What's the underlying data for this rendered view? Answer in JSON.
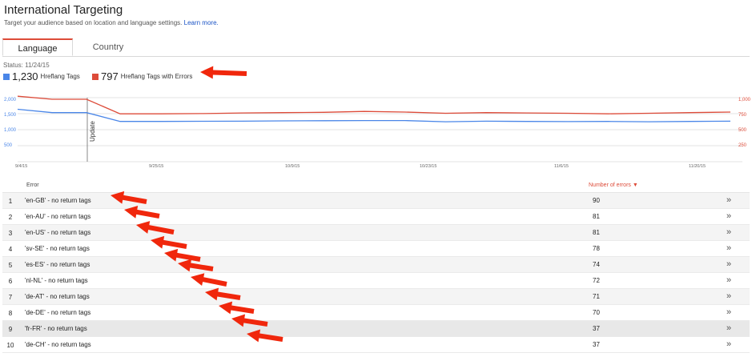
{
  "page": {
    "title": "International Targeting",
    "subtitle": "Target your audience based on location and language settings.",
    "learn_more": "Learn more."
  },
  "tabs": [
    {
      "label": "Language",
      "active": true
    },
    {
      "label": "Country",
      "active": false
    }
  ],
  "status": "Status: 11/24/15",
  "legend": [
    {
      "value": "1,230",
      "label": "Hreflang Tags",
      "color": "#4a86e8"
    },
    {
      "value": "797",
      "label": "Hreflang Tags with Errors",
      "color": "#dd4b39"
    }
  ],
  "chart_data": {
    "type": "line",
    "x_ticks": [
      "9/4/15",
      "9/25/15",
      "10/9/15",
      "10/23/15",
      "11/6/15",
      "11/20/15"
    ],
    "left_axis_ticks": [
      "2,000",
      "1,500",
      "1,000",
      "500"
    ],
    "right_axis_ticks": [
      "1,000",
      "750",
      "500",
      "250"
    ],
    "annotation": "Update",
    "series": [
      {
        "name": "Hreflang Tags",
        "color": "#4a86e8",
        "values": [
          1670,
          1560,
          1560,
          1270,
          1270,
          1275,
          1280,
          1290,
          1295,
          1300,
          1300,
          1260,
          1280,
          1270,
          1265,
          1270,
          1260,
          1270,
          1280
        ]
      },
      {
        "name": "Hreflang Tags with Errors",
        "color": "#dd4b39",
        "values": [
          1050,
          1000,
          1000,
          760,
          760,
          765,
          775,
          780,
          785,
          800,
          790,
          770,
          780,
          775,
          770,
          760,
          770,
          780,
          790
        ]
      }
    ]
  },
  "table": {
    "col_error": "Error",
    "col_count": "Number of errors",
    "rows": [
      {
        "idx": "1",
        "error": "'en-GB' - no return tags",
        "count": "90"
      },
      {
        "idx": "2",
        "error": "'en-AU' - no return tags",
        "count": "81"
      },
      {
        "idx": "3",
        "error": "'en-US' - no return tags",
        "count": "81"
      },
      {
        "idx": "4",
        "error": "'sv-SE' - no return tags",
        "count": "78"
      },
      {
        "idx": "5",
        "error": "'es-ES' - no return tags",
        "count": "74"
      },
      {
        "idx": "6",
        "error": "'nl-NL' - no return tags",
        "count": "72"
      },
      {
        "idx": "7",
        "error": "'de-AT' - no return tags",
        "count": "71"
      },
      {
        "idx": "8",
        "error": "'de-DE' - no return tags",
        "count": "70"
      },
      {
        "idx": "9",
        "error": "'fr-FR' - no return tags",
        "count": "37"
      },
      {
        "idx": "10",
        "error": "'de-CH' - no return tags",
        "count": "37"
      }
    ]
  }
}
